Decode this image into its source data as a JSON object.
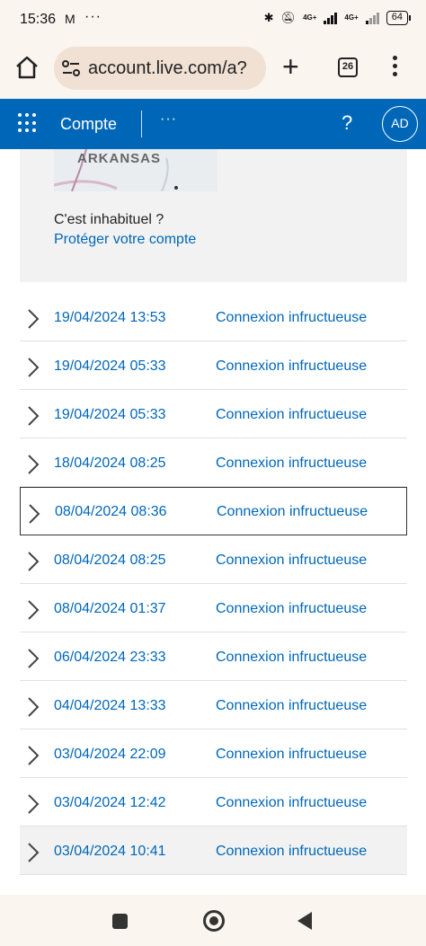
{
  "status_bar": {
    "time": "15:36",
    "mail_icon": "M",
    "more": "···",
    "network": "4G+",
    "network2": "4G+",
    "battery": "64"
  },
  "browser": {
    "url": "account.live.com/a?",
    "tab_count": "26"
  },
  "app_header": {
    "title": "Compte",
    "more": "···",
    "help": "?",
    "avatar_initials": "AD",
    "color": "#0067b8"
  },
  "card": {
    "map_label": "ARKANSAS",
    "question": "C'est inhabituel ?",
    "link": "Protéger votre compte"
  },
  "activity": [
    {
      "date": "19/04/2024 13:53",
      "status": "Connexion infructueuse"
    },
    {
      "date": "19/04/2024 05:33",
      "status": "Connexion infructueuse"
    },
    {
      "date": "19/04/2024 05:33",
      "status": "Connexion infructueuse"
    },
    {
      "date": "18/04/2024 08:25",
      "status": "Connexion infructueuse"
    },
    {
      "date": "08/04/2024 08:36",
      "status": "Connexion infructueuse"
    },
    {
      "date": "08/04/2024 08:25",
      "status": "Connexion infructueuse"
    },
    {
      "date": "08/04/2024 01:37",
      "status": "Connexion infructueuse"
    },
    {
      "date": "06/04/2024 23:33",
      "status": "Connexion infructueuse"
    },
    {
      "date": "04/04/2024 13:33",
      "status": "Connexion infructueuse"
    },
    {
      "date": "03/04/2024 22:09",
      "status": "Connexion infructueuse"
    },
    {
      "date": "03/04/2024 12:42",
      "status": "Connexion infructueuse"
    },
    {
      "date": "03/04/2024 10:41",
      "status": "Connexion infructueuse"
    }
  ]
}
